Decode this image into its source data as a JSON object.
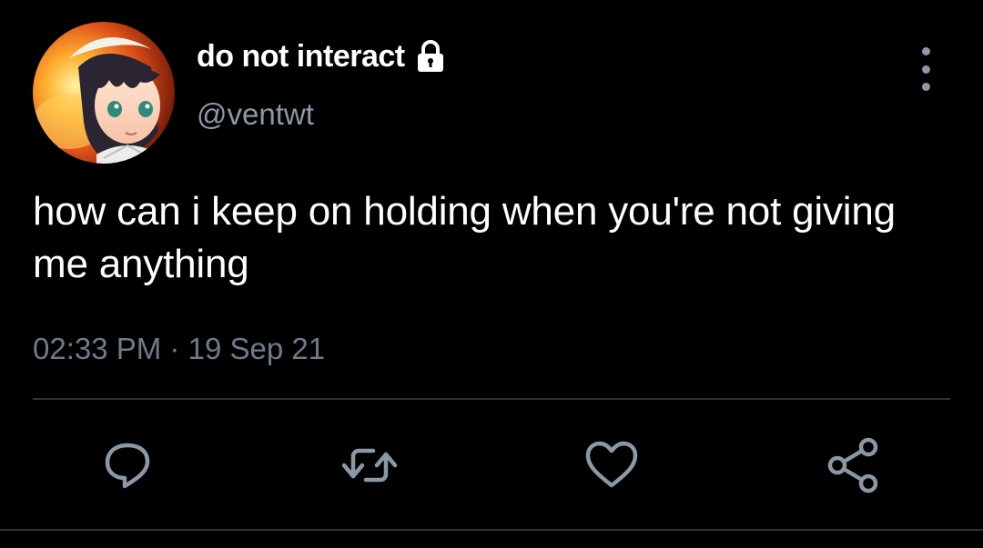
{
  "author": {
    "display_name": "do not interact",
    "handle": "@ventwt",
    "protected_icon": "lock-icon",
    "avatar": "anime-character-avatar"
  },
  "tweet": {
    "text": "how can i keep on holding when you're not giving me anything",
    "time": "02:33 PM",
    "separator": "·",
    "date": "19 Sep 21"
  },
  "actions": [
    {
      "name": "reply",
      "icon": "reply-icon"
    },
    {
      "name": "retweet",
      "icon": "retweet-icon"
    },
    {
      "name": "like",
      "icon": "heart-icon"
    },
    {
      "name": "share",
      "icon": "share-icon"
    }
  ],
  "colors": {
    "background": "#000000",
    "primary_text": "#ffffff",
    "secondary_text": "#8b98a5",
    "divider": "#2f3336"
  }
}
